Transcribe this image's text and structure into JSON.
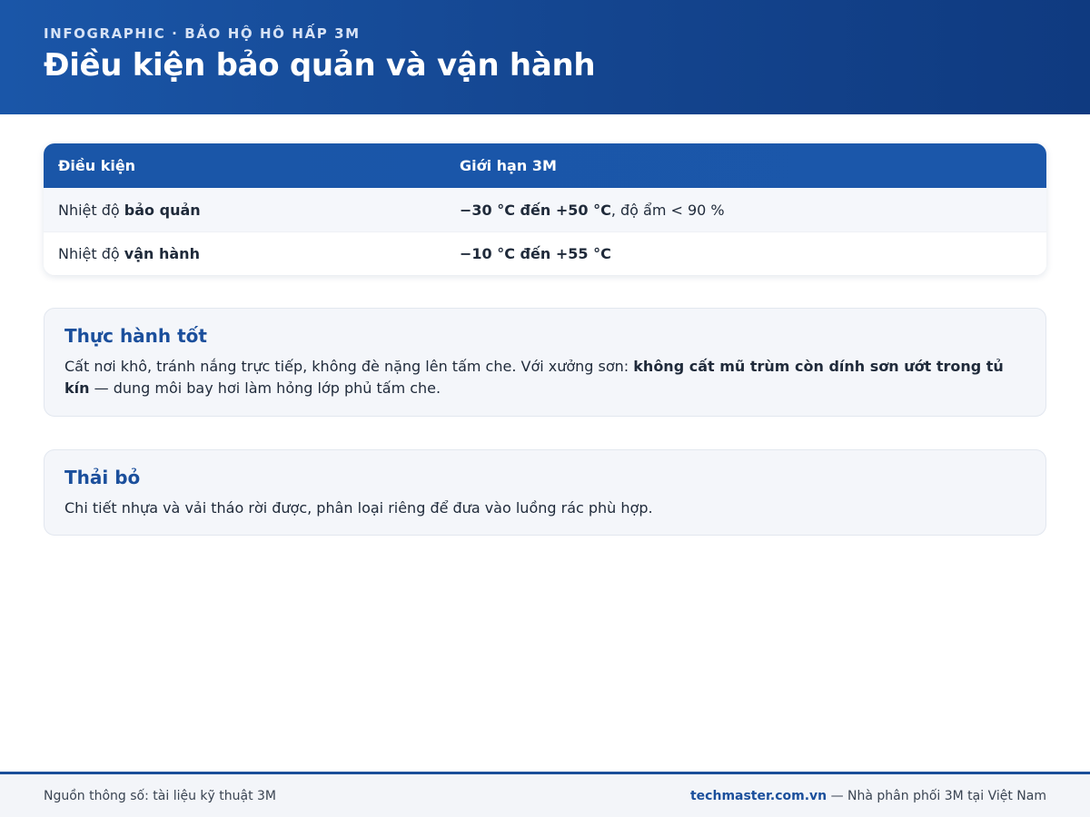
{
  "header": {
    "eyebrow": "INFOGRAPHIC · BẢO HỘ HÔ HẤP 3M",
    "title": "Điều kiện bảo quản và vận hành"
  },
  "table": {
    "columns": [
      "Điều kiện",
      "Giới hạn 3M"
    ],
    "rows": [
      {
        "label_prefix": "Nhiệt độ ",
        "label_bold": "bảo quản",
        "value_bold": "−30 °C đến +50 °C",
        "value_rest": ", độ ẩm < 90 %"
      },
      {
        "label_prefix": "Nhiệt độ ",
        "label_bold": "vận hành",
        "value_bold": "−10 °C đến +55 °C",
        "value_rest": ""
      }
    ]
  },
  "cards": [
    {
      "title": "Thực hành tốt",
      "text_before": "Cất nơi khô, tránh nắng trực tiếp, không đè nặng lên tấm che. Với xưởng sơn: ",
      "text_bold": "không cất mũ trùm còn dính sơn ướt trong tủ kín",
      "text_after": " — dung môi bay hơi làm hỏng lớp phủ tấm che."
    },
    {
      "title": "Thải bỏ",
      "text": "Chi tiết nhựa và vải tháo rời được, phân loại riêng để đưa vào luồng rác phù hợp."
    }
  ],
  "footer": {
    "source": "Nguồn thông số: tài liệu kỹ thuật 3M",
    "site": "techmaster.com.vn",
    "tagline": " — Nhà phân phối 3M tại Việt Nam"
  }
}
